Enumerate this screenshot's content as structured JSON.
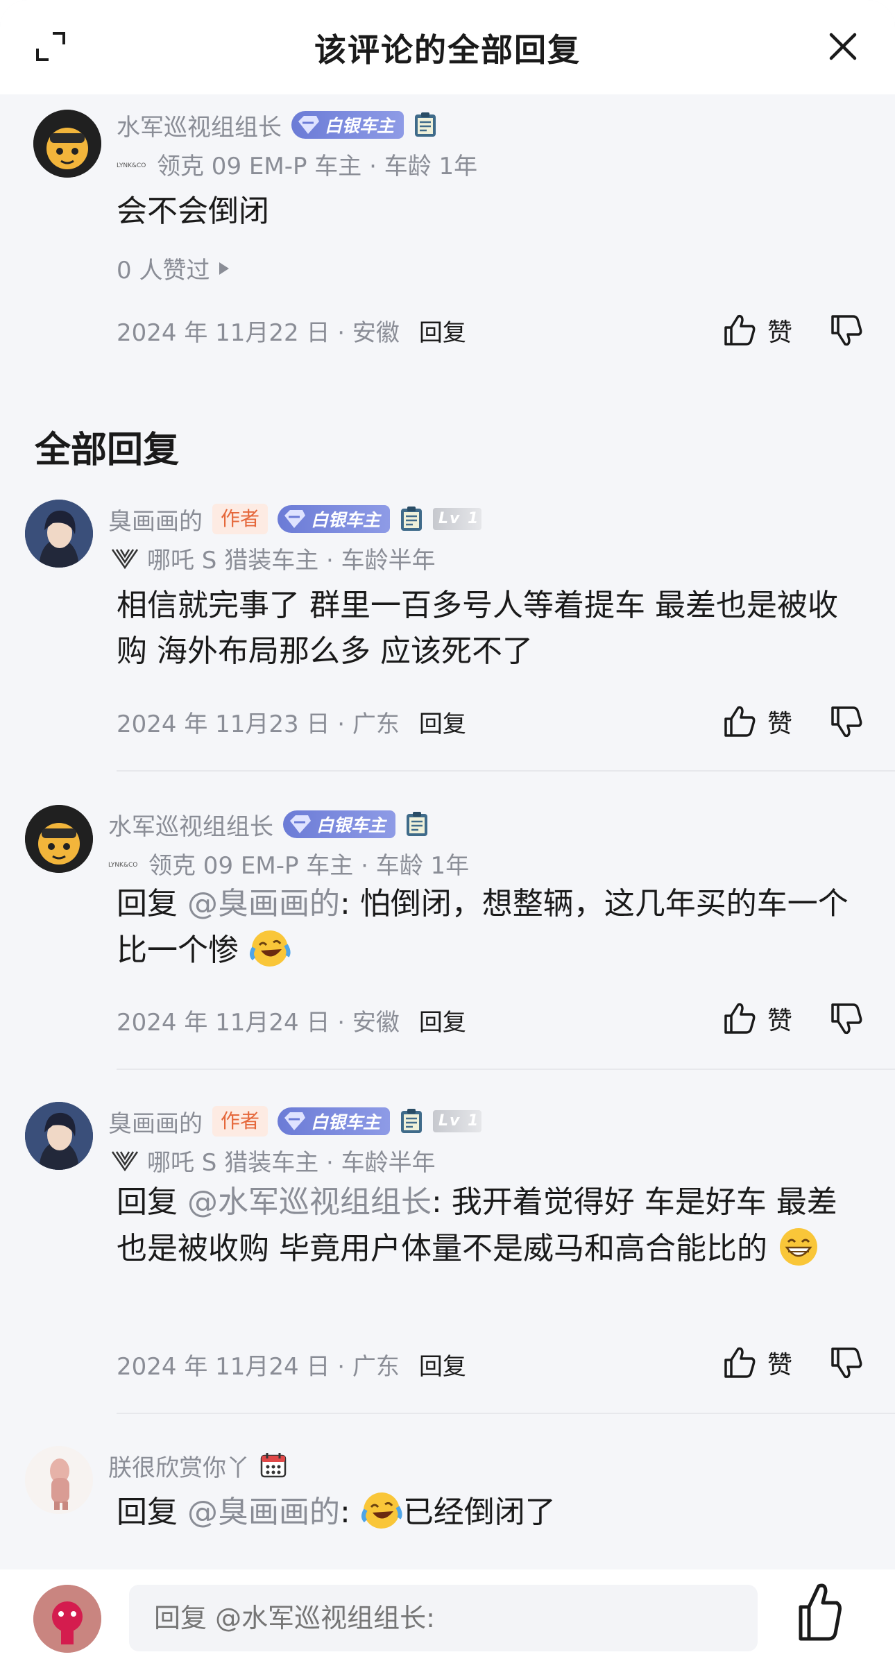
{
  "header": {
    "title": "该评论的全部回复"
  },
  "main_comment": {
    "username": "水军巡视组组长",
    "badge": "白银车主",
    "car_info": "领克 09 EM-P 车主 · 车龄 1年",
    "car_logo_text": "LYNK&CO",
    "text": "会不会倒闭",
    "likes": "0 人赞过",
    "date_location": "2024 年 11月22 日 · 安徽",
    "reply_label": "回复",
    "like_label": "赞"
  },
  "section_title": "全部回复",
  "replies": [
    {
      "username": "臭画画的",
      "author_tag": "作者",
      "badge": "白银车主",
      "level": "Lv 1",
      "car_info": "哪吒 S 猎装车主 · 车龄半年",
      "text": "相信就完事了 群里一百多号人等着提车 最差也是被收购 海外布局那么多 应该死不了",
      "date_location": "2024 年 11月23 日 · 广东",
      "reply_label": "回复",
      "like_label": "赞"
    },
    {
      "username": "水军巡视组组长",
      "badge": "白银车主",
      "car_info": "领克 09 EM-P 车主 · 车龄 1年",
      "car_logo_text": "LYNK&CO",
      "reply_prefix": "回复",
      "mention": "@臭画画的",
      "text": ": 怕倒闭，想整辆，这几年买的车一个比一个惨",
      "date_location": "2024 年 11月24 日 · 安徽",
      "reply_label": "回复",
      "like_label": "赞"
    },
    {
      "username": "臭画画的",
      "author_tag": "作者",
      "badge": "白银车主",
      "level": "Lv 1",
      "car_info": "哪吒 S 猎装车主 · 车龄半年",
      "reply_prefix": "回复",
      "mention": "@水军巡视组组长",
      "text": ": 我开着觉得好 车是好车 最差也是被收购 毕竟用户体量不是威马和高合能比的",
      "date_location": "2024 年 11月24 日 · 广东",
      "reply_label": "回复",
      "like_label": "赞"
    },
    {
      "username": "朕很欣赏你丫",
      "reply_prefix": "回复",
      "mention": "@臭画画的",
      "text": "已经倒闭了"
    }
  ],
  "bottom_bar": {
    "placeholder": "回复 @水军巡视组组长:"
  },
  "icons": {
    "expand": "expand-icon",
    "close": "close-icon",
    "thumb_up": "thumb-up-icon",
    "thumb_down": "thumb-down-icon",
    "laugh_cry_emoji": "laugh-cry-emoji",
    "grin_emoji": "grin-emoji",
    "calendar_badge": "calendar-icon",
    "clipboard_badge": "clipboard-icon"
  },
  "colors": {
    "badge_silver": "#7a88de",
    "author_tag": "#e5673a",
    "meta_gray": "#8a8d96",
    "background": "#f5f6f9"
  }
}
